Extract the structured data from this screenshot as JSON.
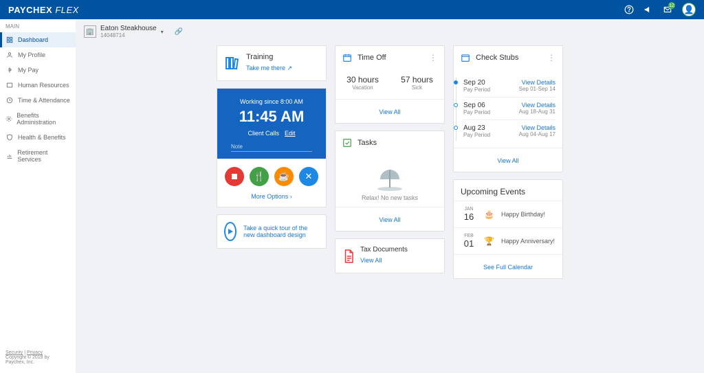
{
  "brand": {
    "name": "PAYCHEX",
    "sub": "FLEX"
  },
  "header": {
    "notif_count": "12"
  },
  "sidebar": {
    "label": "MAIN",
    "items": [
      {
        "label": "Dashboard"
      },
      {
        "label": "My Profile"
      },
      {
        "label": "My Pay"
      },
      {
        "label": "Human Resources"
      },
      {
        "label": "Time & Attendance"
      },
      {
        "label": "Benefits Administration"
      },
      {
        "label": "Health & Benefits"
      },
      {
        "label": "Retirement Services"
      }
    ]
  },
  "footer": {
    "security": "Security",
    "privacy": "Privacy",
    "copyright": "Copyright © 2019 by Paychex, Inc."
  },
  "company": {
    "name": "Eaton Steakhouse",
    "id": "14048714"
  },
  "training": {
    "title": "Training",
    "link": "Take me there"
  },
  "clock": {
    "since": "Working since 8:00 AM",
    "time": "11:45 AM",
    "activity": "Client Calls",
    "edit": "Edit",
    "note_label": "Note",
    "more": "More Options"
  },
  "tour": {
    "text": "Take a quick tour of the new dashboard design"
  },
  "timeoff": {
    "title": "Time Off",
    "vac_val": "30 hours",
    "vac_lbl": "Vacation",
    "sick_val": "57 hours",
    "sick_lbl": "Sick",
    "view_all": "View All"
  },
  "tasks": {
    "title": "Tasks",
    "empty": "Relax! No new tasks",
    "view_all": "View All"
  },
  "tax": {
    "title": "Tax Documents",
    "view_all": "View All"
  },
  "stubs": {
    "title": "Check Stubs",
    "items": [
      {
        "date": "Sep 20",
        "period": "Pay Period",
        "details": "View Details",
        "range": "Sep 01-Sep 14"
      },
      {
        "date": "Sep 06",
        "period": "Pay Period",
        "details": "View Details",
        "range": "Aug 18-Aug 31"
      },
      {
        "date": "Aug 23",
        "period": "Pay Period",
        "details": "View Details",
        "range": "Aug 04-Aug 17"
      }
    ],
    "view_all": "View All"
  },
  "events": {
    "title": "Upcoming Events",
    "items": [
      {
        "month": "JAN",
        "day": "16",
        "label": "Happy Birthday!"
      },
      {
        "month": "FEB",
        "day": "01",
        "label": "Happy Anniversary!"
      }
    ],
    "calendar": "See Full Calendar"
  }
}
